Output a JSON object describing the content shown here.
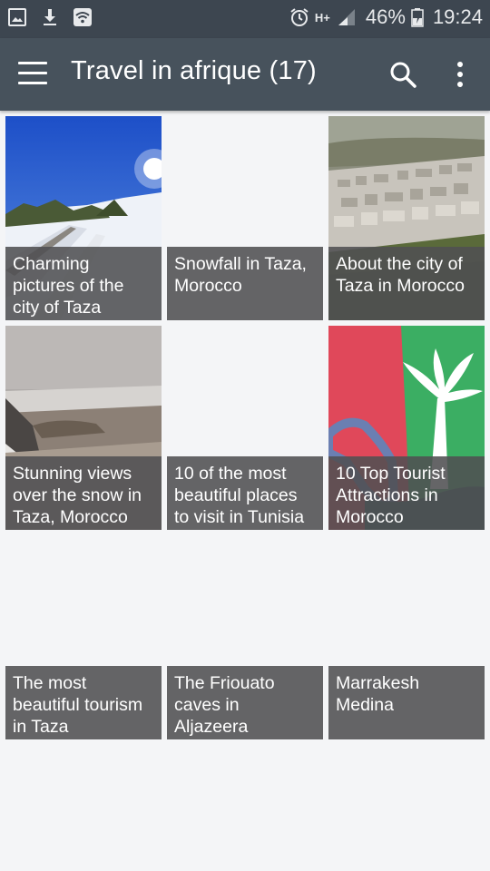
{
  "status_bar": {
    "icons_left": [
      "image-icon",
      "download-icon",
      "wifi-icon"
    ],
    "icons_right": [
      "alarm-icon",
      "hplus-icon",
      "signal-icon",
      "battery-icon"
    ],
    "network": "H+",
    "battery": "46%",
    "time": "19:24"
  },
  "app_bar": {
    "title": "Travel in afrique (17)",
    "menu_icon": "hamburger-icon",
    "search_icon": "search-icon",
    "more_icon": "more-vert-icon"
  },
  "articles": [
    {
      "caption": "Charming pictures of the city of Taza",
      "image": "snow-road-photo"
    },
    {
      "caption": " Snowfall in Taza, Morocco",
      "image": ""
    },
    {
      "caption": "About the city of Taza in Morocco",
      "image": "city-aerial-photo"
    },
    {
      "caption": "Stunning views over the snow in Taza, Morocco",
      "image": "snowy-valley-photo"
    },
    {
      "caption": "10 of the most beautiful places to visit in Tunisia",
      "image": ""
    },
    {
      "caption": "10 Top Tourist Attractions in Morocco",
      "image": "palm-map-illustration"
    },
    {
      "caption": "The most beautiful tourism in Taza",
      "image": ""
    },
    {
      "caption": "The Friouato caves in Aljazeera",
      "image": ""
    },
    {
      "caption": "Marrakesh Medina",
      "image": ""
    }
  ]
}
